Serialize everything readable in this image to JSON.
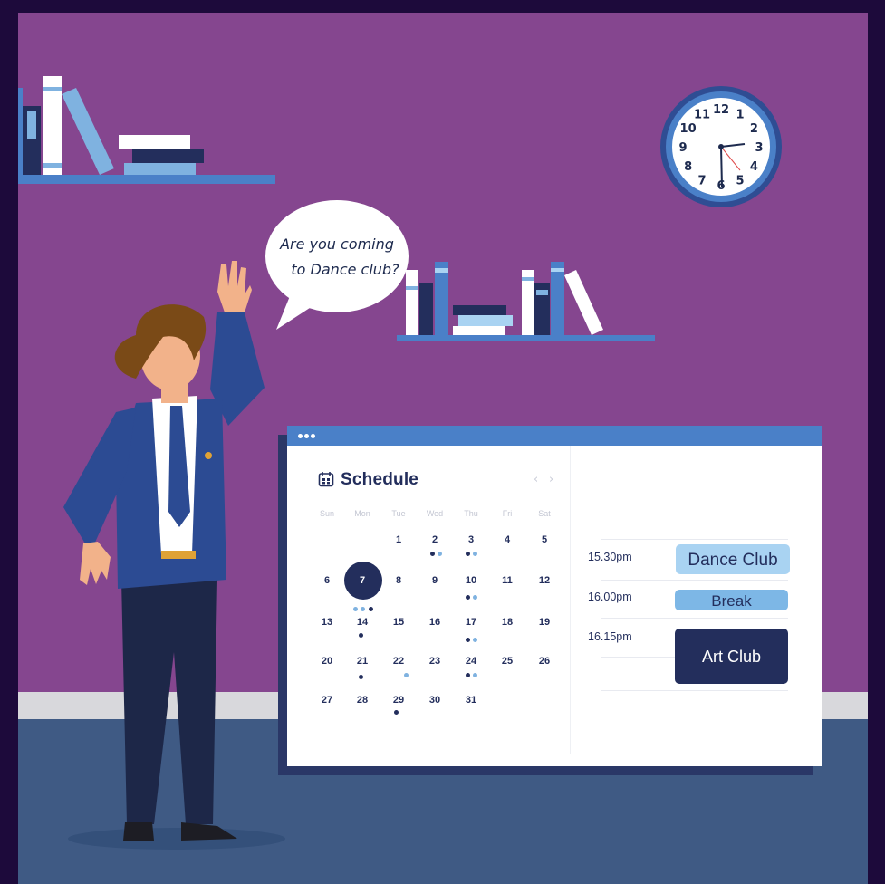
{
  "speech_bubble": {
    "line1": "Are you coming",
    "line2": "to Dance club?"
  },
  "clock": {
    "numbers": [
      "12",
      "1",
      "2",
      "3",
      "4",
      "5",
      "6",
      "7",
      "8",
      "9",
      "10",
      "11"
    ]
  },
  "schedule": {
    "title": "Schedule",
    "icon": "calendar-icon",
    "prev_label": "‹",
    "next_label": "›",
    "day_headers": [
      "Sun",
      "Mon",
      "Tue",
      "Wed",
      "Thu",
      "Fri",
      "Sat"
    ],
    "selected_day": "7",
    "weeks": [
      [
        "",
        "",
        "1",
        "2",
        "3",
        "4",
        "5"
      ],
      [
        "6",
        "7",
        "8",
        "9",
        "10",
        "11",
        "12"
      ],
      [
        "13",
        "14",
        "15",
        "16",
        "17",
        "18",
        "19"
      ],
      [
        "20",
        "21",
        "22",
        "23",
        "24",
        "25",
        "26"
      ],
      [
        "27",
        "28",
        "29",
        "30",
        "31",
        "",
        ""
      ]
    ],
    "events": [
      {
        "time": "15.30pm",
        "label": "Dance Club"
      },
      {
        "time": "16.00pm",
        "label": "Break"
      },
      {
        "time": "16.15pm",
        "label": "Art Club"
      }
    ]
  },
  "colors": {
    "wall": "#85468f",
    "frame": "#1d0a3b",
    "floor": "#3f5a84",
    "navy": "#232e5c",
    "accent_blue": "#4a80c8",
    "light_blue": "#a9d3f2"
  }
}
